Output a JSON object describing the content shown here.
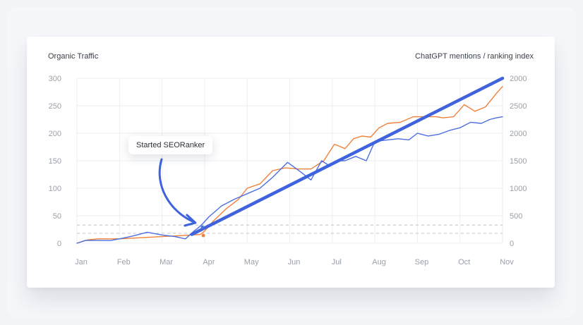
{
  "chart_data": {
    "type": "line",
    "left_axis_label": "Organic Traffic",
    "right_axis_label": "ChatGPT mentions / ranking index",
    "categories": [
      "Jan",
      "Feb",
      "Mar",
      "Apr",
      "May",
      "Jun",
      "Jul",
      "Aug",
      "Sep",
      "Oct",
      "Nov"
    ],
    "y_left_ticks": [
      0,
      50,
      100,
      150,
      200,
      250,
      300
    ],
    "y_right_ticks": [
      0,
      500,
      1000,
      1500,
      2000,
      2500,
      2000
    ],
    "ylim_left": [
      0,
      300
    ],
    "grid": true,
    "annotation": {
      "text": "Started SEORanker",
      "at_month": 2.95
    },
    "series": [
      {
        "color": "#f0813b",
        "x": [
          0,
          0.25,
          0.5,
          1,
          1.5,
          2,
          2.5,
          2.9,
          3,
          3.2,
          3.5,
          3.8,
          4,
          4.3,
          4.6,
          4.9,
          5.2,
          5.5,
          5.8,
          6.05,
          6.3,
          6.5,
          6.7,
          6.9,
          7.1,
          7.3,
          7.6,
          7.9,
          8.2,
          8.45,
          8.6,
          8.85,
          9.1,
          9.35,
          9.6,
          9.85,
          10
        ],
        "values": [
          0,
          6,
          8,
          8,
          10,
          12,
          14,
          16,
          22,
          40,
          62,
          80,
          100,
          108,
          132,
          137,
          135,
          135,
          150,
          180,
          172,
          190,
          195,
          193,
          210,
          218,
          220,
          230,
          230,
          230,
          228,
          230,
          252,
          240,
          248,
          272,
          285
        ]
      },
      {
        "color": "#4b6fe0",
        "x": [
          0,
          0.2,
          0.5,
          0.8,
          1,
          1.3,
          1.65,
          2,
          2.3,
          2.55,
          2.75,
          2.85,
          2.95,
          3.1,
          3.4,
          3.7,
          4,
          4.3,
          4.6,
          4.95,
          5.25,
          5.5,
          5.75,
          5.95,
          6.1,
          6.3,
          6.55,
          6.8,
          7,
          7.3,
          7.55,
          7.8,
          8,
          8.25,
          8.5,
          8.75,
          9,
          9.25,
          9.5,
          9.7,
          9.85,
          10
        ],
        "values": [
          0,
          5,
          5,
          5,
          8,
          13,
          20,
          15,
          12,
          8,
          22,
          28,
          35,
          48,
          68,
          80,
          90,
          100,
          120,
          147,
          130,
          115,
          150,
          140,
          150,
          150,
          158,
          150,
          185,
          188,
          190,
          188,
          200,
          195,
          198,
          205,
          210,
          220,
          218,
          225,
          228,
          230
        ]
      },
      {
        "color": "#3e63dd",
        "x": [
          2.7,
          10
        ],
        "values": [
          16,
          300
        ]
      }
    ]
  }
}
